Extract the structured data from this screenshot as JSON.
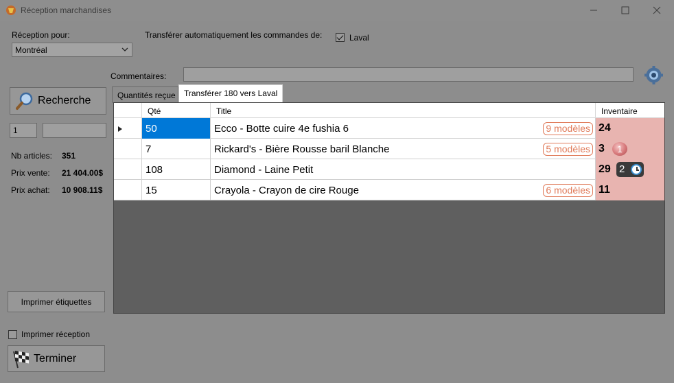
{
  "window": {
    "title": "Réception marchandises"
  },
  "reception": {
    "label": "Réception pour:",
    "selected": "Montréal",
    "auto_transfer_label": "Transférer automatiquement les commandes de:",
    "auto_transfer_option": "Laval",
    "auto_transfer_checked": true
  },
  "comments": {
    "label": "Commentaires:",
    "value": ""
  },
  "search": {
    "button_label": "Recherche",
    "qty_value": "1",
    "code_value": ""
  },
  "stats": {
    "nb_articles_label": "Nb articles:",
    "nb_articles_value": "351",
    "prix_vente_label": "Prix vente:",
    "prix_vente_value": "21 404.00$",
    "prix_achat_label": "Prix achat:",
    "prix_achat_value": "10 908.11$"
  },
  "tabs": [
    {
      "label": "Quantités reçue",
      "active": false
    },
    {
      "label": "Transférer 180 vers Laval",
      "active": true
    }
  ],
  "grid": {
    "headers": {
      "qty": "Qté",
      "title": "Title",
      "inventory": "Inventaire"
    },
    "rows": [
      {
        "qty": "50",
        "title": "Ecco - Botte cuire 4e fushia 6",
        "models": "9 modèles",
        "inventory": "24",
        "selected": true
      },
      {
        "qty": "7",
        "title": "Rickard's - Bière Rousse baril Blanche",
        "models": "5 modèles",
        "inventory": "3",
        "badge": "1"
      },
      {
        "qty": "108",
        "title": "Diamond - Laine Petit",
        "models": "",
        "inventory": "29",
        "badge": "2"
      },
      {
        "qty": "15",
        "title": "Crayola - Crayon de cire Rouge",
        "models": "6 modèles",
        "inventory": "11"
      }
    ]
  },
  "actions": {
    "print_labels": "Imprimer étiquettes",
    "print_reception_label": "Imprimer réception",
    "print_reception_checked": false,
    "finish": "Terminer"
  },
  "colors": {
    "selection": "#0078d7",
    "inventory_bg": "#e8b4b0",
    "models_badge": "#e07b5a"
  },
  "icons": [
    "app-icon",
    "chevron-down-icon",
    "checkmark-icon",
    "gear-icon",
    "magnifier-icon",
    "checkered-flag-icon",
    "clock-icon",
    "row-pointer-icon"
  ]
}
